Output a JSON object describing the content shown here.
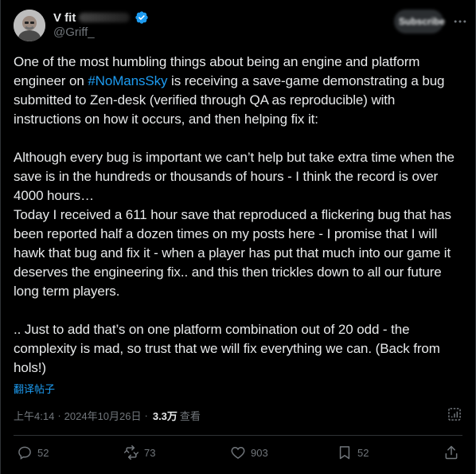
{
  "author": {
    "display_name": "V        fit",
    "handle": "@Griff_",
    "verified": true
  },
  "subscribe_label": "Subscribe",
  "post": {
    "para1_before": "One of the most humbling things about being an engine and platform engineer on ",
    "hashtag": "#NoMansSky",
    "para1_after": " is receiving a save-game demonstrating a bug submitted to Zen-desk (verified through QA as reproducible) with instructions on how it occurs, and then helping fix it:",
    "para2": "Although every bug is important we can’t help but take extra time when the save is in the hundreds or thousands of hours - I think the record is over 4000 hours…",
    "para3": "Today I received a 611 hour save that reproduced a flickering bug that has been reported half a dozen times on my posts here - I promise that I will hawk that bug and fix it - when a player has put that much into our game it deserves the engineering fix.. and this then trickles down to all our future long term players.",
    "para4": ".. Just to add that’s on one platform combination out of 20 odd - the complexity is mad, so trust that we will fix everything we can. (Back from hols!)"
  },
  "translate_label": "翻译帖子",
  "meta": {
    "time": "上午4:14",
    "separator": "·",
    "date": "2024年10月26日",
    "separator2": "·",
    "views_count": "3.3万",
    "views_label": "查看"
  },
  "actions": {
    "replies": "52",
    "reposts": "73",
    "likes": "903",
    "bookmarks": "52"
  },
  "colors": {
    "background": "#000000",
    "text": "#e7e9ea",
    "muted": "#71767b",
    "accent": "#1d9bf0",
    "divider": "#2f3336"
  },
  "icons": {
    "verified": "verified-badge-icon",
    "more": "more-icon",
    "analytics": "analytics-icon",
    "reply": "reply-icon",
    "repost": "repost-icon",
    "like": "like-icon",
    "bookmark": "bookmark-icon",
    "share": "share-icon"
  }
}
